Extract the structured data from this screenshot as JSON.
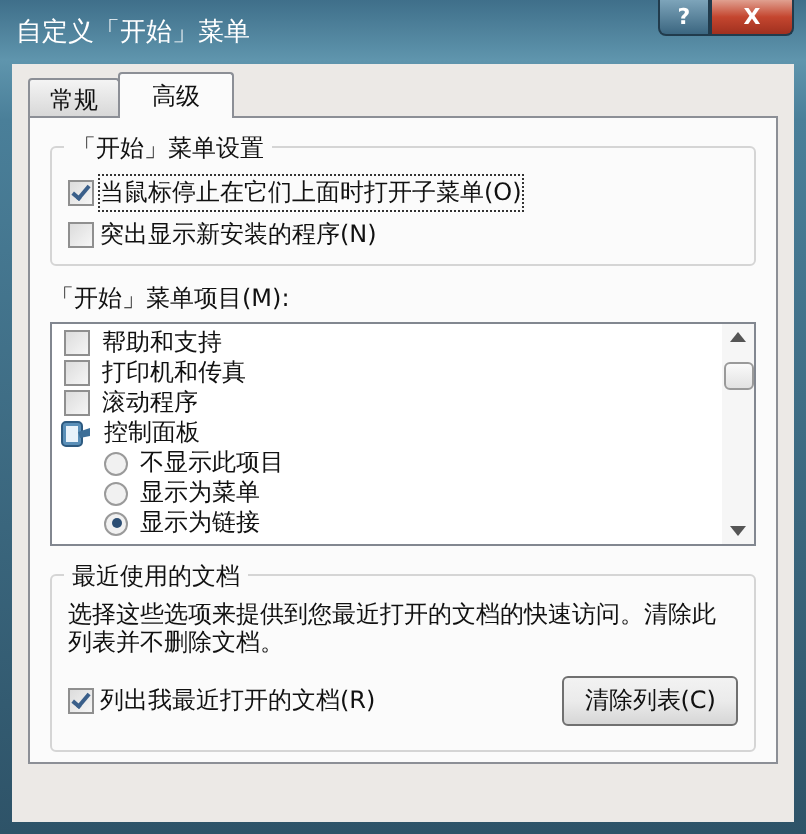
{
  "window": {
    "title": "自定义「开始」菜单",
    "buttons": [
      "?",
      "X"
    ]
  },
  "tabs": [
    {
      "label": "常规",
      "selected": false
    },
    {
      "label": "高级",
      "selected": true
    }
  ],
  "start_menu_settings": {
    "title": "「开始」菜单设置",
    "options": [
      {
        "label": "当鼠标停止在它们上面时打开子菜单(O)",
        "checked": true,
        "focused": true
      },
      {
        "label": "突出显示新安装的程序(N)",
        "checked": false,
        "focused": false
      }
    ]
  },
  "start_menu_items": {
    "label": "「开始」菜单项目(M):",
    "items": [
      {
        "kind": "checkbox",
        "label": "帮助和支持",
        "checked": false
      },
      {
        "kind": "checkbox",
        "label": "打印机和传真",
        "checked": false
      },
      {
        "kind": "checkbox",
        "label": "滚动程序",
        "checked": false
      },
      {
        "kind": "group",
        "label": "控制面板",
        "children": [
          {
            "label": "不显示此项目",
            "selected": false
          },
          {
            "label": "显示为菜单",
            "selected": false
          },
          {
            "label": "显示为链接",
            "selected": true
          }
        ]
      }
    ]
  },
  "recent_documents": {
    "title": "最近使用的文档",
    "description": "选择这些选项来提供到您最近打开的文档的快速访问。清除此列表并不删除文档。",
    "option": {
      "label": "列出我最近打开的文档(R)",
      "checked": true
    },
    "button": "清除列表(C)"
  }
}
